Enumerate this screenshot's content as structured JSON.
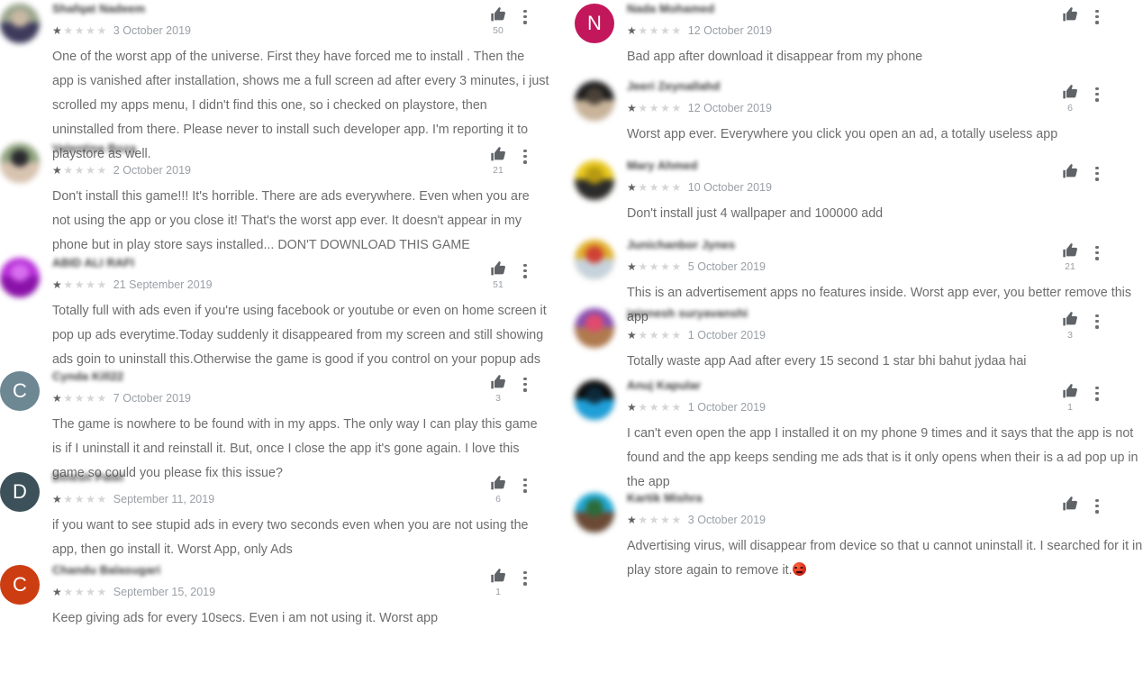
{
  "page": {
    "app": "Google Play Store — user reviews list",
    "background_color": "#ffffff",
    "star_filled_color": "#636363",
    "star_empty_color": "#d6d6d6",
    "body_text_color": "#6d6d6d",
    "date_color": "#9aa0a6",
    "kebab_icon": "more-vert-icon",
    "thumb_icon": "thumb-up-icon",
    "star_filled_glyph": "★",
    "star_empty_glyph": "★"
  },
  "columns": [
    {
      "id": "left",
      "reviews": [
        {
          "author": "Shafqat Nadeem",
          "rating": 1,
          "date": "3 October 2019",
          "likes": "50",
          "text": "One of the worst app of the universe. First they have forced me to install . Then the app is vanished after installation, shows me a full screen ad after every 3 minutes, i just scrolled my apps menu, I didn't find this one, so i checked on playstore, then uninstalled from there. Please never to install such developer app. I'm reporting it to playstore as well.",
          "avatar": {
            "type": "photo",
            "colors": [
              "#9aa58c",
              "#3d3a5c",
              "#c9b9a4"
            ]
          }
        },
        {
          "author": "Valentina Boza",
          "rating": 1,
          "date": "2 October 2019",
          "likes": "21",
          "text": "Don't install this game!!! It's horrible. There are ads everywhere. Even when you are not using the app or you close it! That's the worst app ever. It doesn't appear in my phone but in play store says installed... DON'T DOWNLOAD THIS GAME",
          "avatar": {
            "type": "photo",
            "colors": [
              "#8ea37e",
              "#d8c3b0",
              "#2a2a2e"
            ]
          }
        },
        {
          "author": "ABID ALI RAFI",
          "rating": 1,
          "date": "21 September 2019",
          "likes": "51",
          "text": "Totally full with ads even if you're using facebook or youtube or even on home screen it pop up ads everytime.Today suddenly it disappeared from my screen and still showing ads goin to uninstall this.Otherwise the game is good if you control on your popup ads",
          "avatar": {
            "type": "photo",
            "colors": [
              "#b830d8",
              "#8a12a8",
              "#d76ef0"
            ]
          }
        },
        {
          "author": "Cynda Kill22",
          "rating": 1,
          "date": "7 October 2019",
          "likes": "3",
          "text": "The game is nowhere to be found with in my apps. The only way I can play this game is if I uninstall it and reinstall it. But, once I close the app it's gone again. I love this game so could you please fix this issue?",
          "avatar": {
            "type": "letter",
            "letter": "C",
            "color": "#6d8793"
          }
        },
        {
          "author": "Dinesh Patel",
          "rating": 1,
          "date": "September 11, 2019",
          "likes": "6",
          "text": "if you want to see stupid ads in every two seconds even when you are not using the app, then go install it. Worst App, only Ads",
          "avatar": {
            "type": "letter",
            "letter": "D",
            "color": "#3d515a"
          }
        },
        {
          "author": "Chandu Balasugari",
          "rating": 1,
          "date": "September 15, 2019",
          "likes": "1",
          "text": "Keep giving ads for every 10secs. Even i am not using it. Worst app",
          "avatar": {
            "type": "letter",
            "letter": "C",
            "color": "#cc3d12"
          }
        }
      ]
    },
    {
      "id": "right",
      "reviews": [
        {
          "author": "Nada Mohamed",
          "rating": 1,
          "date": "12 October 2019",
          "likes": "",
          "text": "Bad app after download it disappear from my phone",
          "avatar": {
            "type": "letter",
            "letter": "N",
            "color": "#c2185b"
          }
        },
        {
          "author": "Jeeri Zeynallahd",
          "rating": 1,
          "date": "12 October 2019",
          "likes": "6",
          "text": "Worst app ever. Everywhere you click you open an ad, a totally useless app",
          "avatar": {
            "type": "photo",
            "colors": [
              "#1a1a1a",
              "#c9b49a",
              "#4a4238"
            ]
          }
        },
        {
          "author": "Mary Ahmed",
          "rating": 1,
          "date": "10 October 2019",
          "likes": "",
          "text": "Don't install just 4 wallpaper and 100000 add",
          "avatar": {
            "type": "photo",
            "colors": [
              "#e8c81e",
              "#2b2b2b",
              "#b89a12"
            ]
          }
        },
        {
          "author": "Junichanbor Jynes",
          "rating": 1,
          "date": "5 October 2019",
          "likes": "21",
          "text": "This is an advertisement apps no features inside. Worst app ever, you better remove this app",
          "avatar": {
            "type": "photo",
            "colors": [
              "#e0b02a",
              "#c6d2dc",
              "#cf4034"
            ]
          }
        },
        {
          "author": "jainnesh suryavanshi",
          "rating": 1,
          "date": "1 October 2019",
          "likes": "3",
          "text": "Totally waste app Aad after every 15 second 1 star bhi bahut jydaa hai",
          "avatar": {
            "type": "photo",
            "colors": [
              "#8a4fb0",
              "#b07a4e",
              "#e24a6e"
            ]
          }
        },
        {
          "author": "Anuj Kapular",
          "rating": 1,
          "date": "1 October 2019",
          "likes": "1",
          "text": "I can't even open the app I installed it on my phone 9 times and it says that the app is not found and the app keeps sending me ads that is it only opens when their is a ad pop up in the app",
          "avatar": {
            "type": "photo",
            "colors": [
              "#0a0a0a",
              "#1f9fd8",
              "#0d2a3a"
            ]
          }
        },
        {
          "author": "Kartik Mishra",
          "rating": 1,
          "date": "3 October 2019",
          "likes": "",
          "text": "Advertising virus, will disappear from device so that u cannot uninstall it. I searched for it in play store again to remove it.",
          "text_suffix_emoji": "angry-face-emoji",
          "avatar": {
            "type": "photo",
            "colors": [
              "#1fa8d4",
              "#6b4a35",
              "#2c6b3a"
            ]
          }
        }
      ]
    }
  ]
}
